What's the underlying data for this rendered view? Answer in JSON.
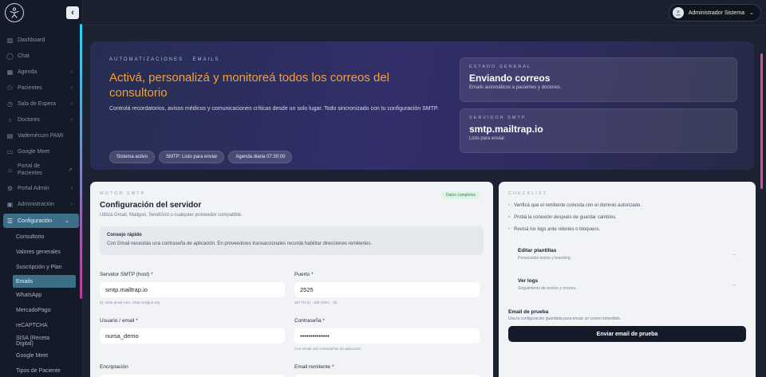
{
  "sidebar": {
    "items": [
      {
        "label": "Dashboard",
        "icon": "chart-icon",
        "chev": false
      },
      {
        "label": "Chat",
        "icon": "chat-icon",
        "chev": false
      },
      {
        "label": "Agenda",
        "icon": "calendar-icon",
        "chev": true
      },
      {
        "label": "Pacientes",
        "icon": "users-icon",
        "chev": true
      },
      {
        "label": "Sala de Espera",
        "icon": "clock-icon",
        "chev": true
      },
      {
        "label": "Doctores",
        "icon": "doctor-icon",
        "chev": true
      },
      {
        "label": "Vademécum PAMI",
        "icon": "book-icon",
        "chev": false
      },
      {
        "label": "Google Meet",
        "icon": "video-icon",
        "chev": false
      },
      {
        "label": "Portal de Pacientes",
        "icon": "portal-icon",
        "chev": false
      },
      {
        "label": "Portal Admin",
        "icon": "gear-icon",
        "chev": true
      },
      {
        "label": "Administración",
        "icon": "building-icon",
        "chev": true
      }
    ],
    "active": {
      "label": "Configuración",
      "icon": "sliders-icon"
    },
    "subitems": [
      "Consultorio",
      "Valores generales",
      "Suscripción y Plan",
      "Emails",
      "WhatsApp",
      "MercadoPago",
      "reCAPTCHA",
      "SISA (Receta Digital)",
      "Google Meet",
      "Tipos de Paciente"
    ],
    "selected_sub": "Emails"
  },
  "topbar": {
    "user_name": "Administrador Sistema"
  },
  "hero": {
    "kicker": "AUTOMATIZACIONES · EMAILS",
    "title": "Activá, personalizá y monitoreá todos los correos del consultorio",
    "description": "Controlá recordatorios, avisos médicos y comunicaciones críticas desde un solo lugar. Todo sincronizado con tu configuración SMTP.",
    "chips": [
      "Sistema activo",
      "SMTP: Listo para enviar",
      "Agenda diaria 07:30:00"
    ],
    "cards": [
      {
        "kicker": "ESTADO GENERAL",
        "value": "Enviando correos",
        "sub": "Emails automáticos a pacientes y doctores."
      },
      {
        "kicker": "SERVIDOR SMTP",
        "value": "smtp.mailtrap.io",
        "sub": "Listo para enviar"
      }
    ]
  },
  "smtp": {
    "kicker": "MOTOR SMTP",
    "title": "Configuración del servidor",
    "subtitle": "Utilizá Gmail, Mailgun, SendGrid o cualquier proveedor compatible.",
    "badge": "Datos completos",
    "tip_title": "Consejo rápido",
    "tip_text": "Con Gmail necesitás una contraseña de aplicación. En proveedores transaccionales recordá habilitar direcciones remitentes.",
    "host_label": "Servidor SMTP (host) *",
    "host_value": "smtp.mailtrap.io",
    "host_hint": "Ej: smtp.gmail.com, smtp.mailgun.org",
    "port_label": "Puerto *",
    "port_value": "2525",
    "port_hint": "587 (TLS) · 465 (SSL) · 25",
    "user_label": "Usuario / email *",
    "user_value": "nursa_demo",
    "pass_label": "Contraseña *",
    "pass_value": "••••••••••••••",
    "pass_hint": "Con Gmail usá contraseñas de aplicación.",
    "enc_label": "Encriptación",
    "sender_label": "Email remitente *"
  },
  "checklist": {
    "kicker": "CHECKLIST",
    "items": [
      "Verificá que el remitente coincida con el dominio autorizado.",
      "Probá la conexión después de guardar cambios.",
      "Revisá los logs ante rebotes o bloqueos."
    ],
    "links": [
      {
        "title": "Editar plantillas",
        "sub": "Personalizá textos y branding."
      },
      {
        "title": "Ver logs",
        "sub": "Seguimiento de envíos y errores."
      }
    ],
    "test_title": "Email de prueba",
    "test_sub": "Usa la configuración guardada para enviar un correo inmediato.",
    "test_button": "Enviar email de prueba"
  }
}
